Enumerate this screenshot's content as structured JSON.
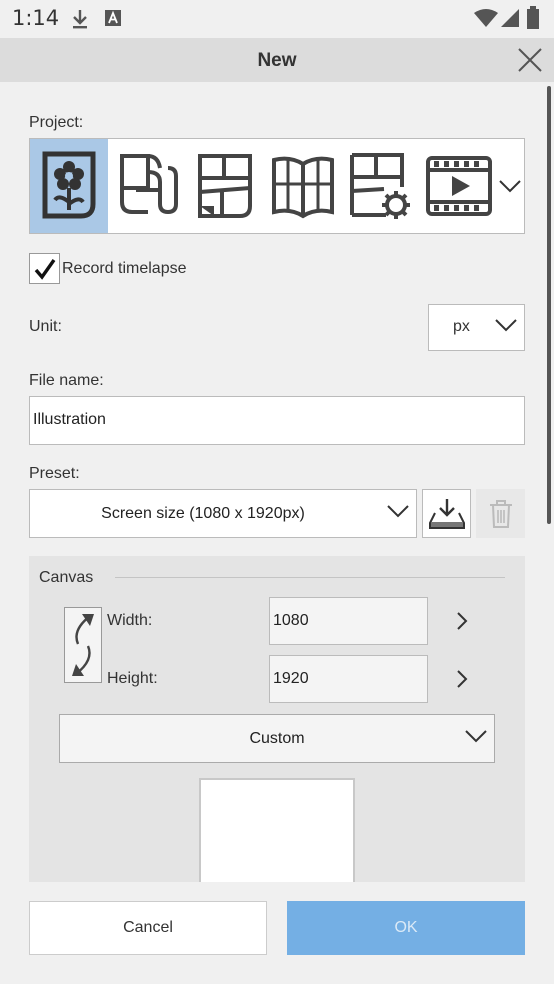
{
  "status_bar": {
    "time": "1:14",
    "icons": [
      "download-icon",
      "text-a-icon",
      "wifi-icon",
      "signal-icon",
      "battery-icon"
    ]
  },
  "dialog": {
    "title": "New",
    "close_icon": "close-icon"
  },
  "project": {
    "label": "Project:",
    "items": [
      {
        "name": "illustration",
        "icon": "flower-page-icon",
        "selected": true
      },
      {
        "name": "webtoon",
        "icon": "scroll-page-icon",
        "selected": false
      },
      {
        "name": "comic",
        "icon": "comic-panels-icon",
        "selected": false
      },
      {
        "name": "book",
        "icon": "open-book-icon",
        "selected": false
      },
      {
        "name": "comic-settings",
        "icon": "panels-gear-icon",
        "selected": false
      },
      {
        "name": "animation",
        "icon": "film-icon",
        "selected": false
      }
    ]
  },
  "timelapse": {
    "label": "Record timelapse",
    "checked": true
  },
  "unit": {
    "label": "Unit:",
    "value": "px"
  },
  "file_name": {
    "label": "File name:",
    "value": "Illustration"
  },
  "preset": {
    "label": "Preset:",
    "value": "Screen size (1080 x 1920px)"
  },
  "canvas": {
    "heading": "Canvas",
    "width_label": "Width:",
    "width_value": "1080",
    "height_label": "Height:",
    "height_value": "1920",
    "size_option": "Custom"
  },
  "footer": {
    "cancel_label": "Cancel",
    "ok_label": "OK"
  },
  "colors": {
    "selected_bg": "#aac8e6",
    "ok_button": "#74afe4",
    "title_bar": "#dcdcdc",
    "canvas_panel": "#e4e4e4"
  }
}
